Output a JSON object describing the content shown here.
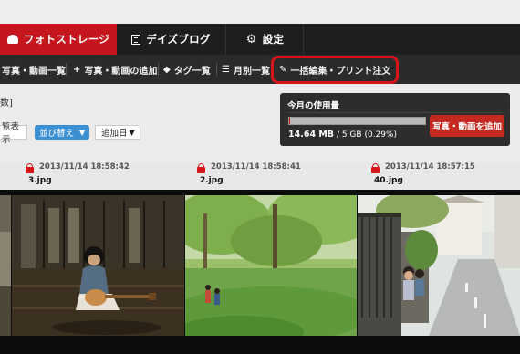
{
  "main_nav": {
    "tabs": [
      {
        "label": "フォトストレージ",
        "icon": "cloud-icon"
      },
      {
        "label": "デイズブログ",
        "icon": "blog-icon"
      },
      {
        "label": "設定",
        "icon": "gear-icon"
      }
    ]
  },
  "sub_nav": {
    "items": [
      {
        "label": "写真・動画一覧"
      },
      {
        "label": "写真・動画の追加",
        "icon": "plus-icon"
      },
      {
        "label": "タグ一覧",
        "icon": "tag-icon"
      },
      {
        "label": "月別一覧",
        "icon": "list-icon"
      },
      {
        "label": "一括編集・プリント注文",
        "icon": "pen-icon"
      }
    ]
  },
  "page": {
    "bracket_text": "数]"
  },
  "usage": {
    "title": "今月の使用量",
    "used": "14.64 MB",
    "total": "/ 5 GB",
    "percent": "(0.29%)",
    "fill_fraction": 0.0029,
    "add_button": "写真・動画を追加"
  },
  "controls": {
    "display_label": "覧表示",
    "sort_label": "並び替え",
    "sort_arrow": "▼",
    "sort_by": "追加日",
    "sort_by_arrow": "▼"
  },
  "photos": [
    {
      "date": "2013/11/14 18:58:42",
      "name": "3.jpg"
    },
    {
      "date": "2013/11/14 18:58:41",
      "name": "2.jpg"
    },
    {
      "date": "2013/11/14 18:57:15",
      "name": "40.jpg"
    }
  ],
  "colors": {
    "brand_red": "#c4161c",
    "highlight": "#d8141b",
    "sort_blue": "#3b8fd3"
  }
}
